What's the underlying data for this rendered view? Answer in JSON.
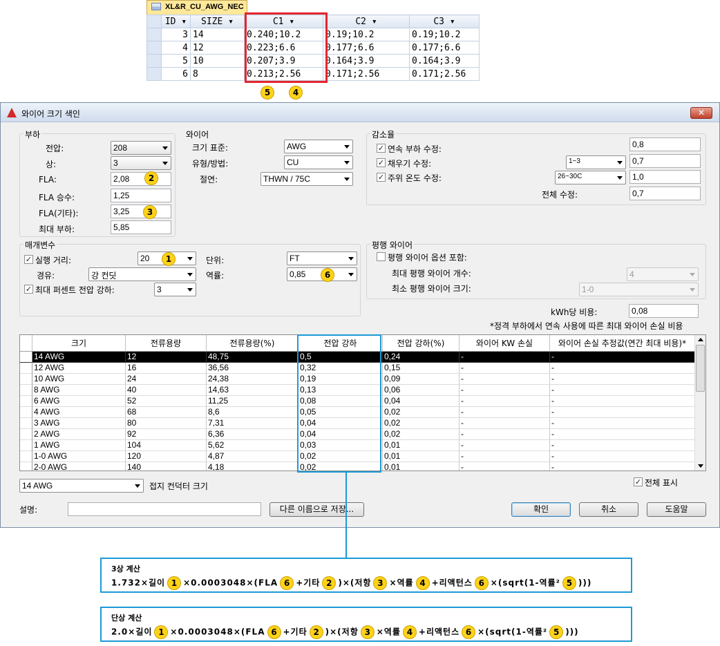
{
  "db": {
    "tab_title": "XL&R_CU_AWG_NEC",
    "headers": [
      "ID",
      "SIZE",
      "C1",
      "C2",
      "C3"
    ],
    "rows": [
      {
        "id": "3",
        "size": "14",
        "c1": "0.240;10.2",
        "c2": "0.19;10.2",
        "c3": "0.19;10.2"
      },
      {
        "id": "4",
        "size": "12",
        "c1": "0.223;6.6",
        "c2": "0.177;6.6",
        "c3": "0.177;6.6"
      },
      {
        "id": "5",
        "size": "10",
        "c1": "0.207;3.9",
        "c2": "0.164;3.9",
        "c3": "0.164;3.9"
      },
      {
        "id": "6",
        "size": "8",
        "c1": "0.213;2.56",
        "c2": "0.171;2.56",
        "c3": "0.171;2.56"
      }
    ]
  },
  "markers": {
    "m1": "1",
    "m2": "2",
    "m3": "3",
    "m4": "4",
    "m5": "5",
    "m6": "6"
  },
  "dialog": {
    "title": "와이어 크기 색인",
    "close": "✕",
    "load": {
      "legend": "부하",
      "voltage_label": "전압:",
      "voltage": "208",
      "phase_label": "상:",
      "phase": "3",
      "fla_label": "FLA:",
      "fla": "2,08",
      "fla_mult_label": "FLA 승수:",
      "fla_mult": "1,25",
      "fla_other_label": "FLA(기타):",
      "fla_other": "3,25",
      "max_load_label": "최대 부하:",
      "max_load": "5,85"
    },
    "wire": {
      "legend": "와이어",
      "size_std_label": "크기 표준:",
      "size_std": "AWG",
      "type_label": "유형/방법:",
      "type": "CU",
      "insulation_label": "절연:",
      "insulation": "THWN / 75C"
    },
    "derating": {
      "legend": "감소율",
      "continuous_label": "연속 부하 수정:",
      "continuous": "0,8",
      "fill_label": "채우기 수정:",
      "fill_combo": "1~3",
      "fill": "0,7",
      "temp_label": "주위 온도 수정:",
      "temp_combo": "26~30C",
      "temp": "1,0",
      "total_label": "전체 수정:",
      "total": "0,7"
    },
    "params": {
      "legend": "매개변수",
      "run_label": "실행 거리:",
      "run": "20",
      "unit_label": "단위:",
      "unit": "FT",
      "conduit_label": "경유:",
      "conduit": "강 컨딧",
      "pf_label": "역률:",
      "pf": "0,85",
      "max_drop_label": "최대 퍼센트 전압 강하:",
      "max_drop": "3"
    },
    "parallel": {
      "legend": "평행 와이어",
      "include_label": "평행 와이어 옵션 포함:",
      "max_count_label": "최대 평행 와이어 개수:",
      "max_count": "4",
      "min_size_label": "최소 평행 와이어 크기:",
      "min_size": "1-0"
    },
    "kwh_label": "kWh당 비용:",
    "kwh": "0,08",
    "note": "*정격 부하에서 연속 사용에 따른 최대 와이어 손실 비용",
    "grid": {
      "headers": [
        "크기",
        "전류용량",
        "전류용량(%)",
        "전압 강하",
        "전압 강하(%)",
        "와이어 KW 손실",
        "와이어 손실 추정값(연간 최대 비용)*"
      ],
      "rows": [
        [
          "14 AWG",
          "12",
          "48,75",
          "0,5",
          "0,24",
          "-",
          "-"
        ],
        [
          "12 AWG",
          "16",
          "36,56",
          "0,32",
          "0,15",
          "-",
          "-"
        ],
        [
          "10 AWG",
          "24",
          "24,38",
          "0,19",
          "0,09",
          "-",
          "-"
        ],
        [
          "8 AWG",
          "40",
          "14,63",
          "0,13",
          "0,06",
          "-",
          "-"
        ],
        [
          "6 AWG",
          "52",
          "11,25",
          "0,08",
          "0,04",
          "-",
          "-"
        ],
        [
          "4 AWG",
          "68",
          "8,6",
          "0,05",
          "0,02",
          "-",
          "-"
        ],
        [
          "3 AWG",
          "80",
          "7,31",
          "0,04",
          "0,02",
          "-",
          "-"
        ],
        [
          "2 AWG",
          "92",
          "6,36",
          "0,04",
          "0,02",
          "-",
          "-"
        ],
        [
          "1 AWG",
          "104",
          "5,62",
          "0,03",
          "0,01",
          "-",
          "-"
        ],
        [
          "1-0 AWG",
          "120",
          "4,87",
          "0,02",
          "0,01",
          "-",
          "-"
        ],
        [
          "2-0 AWG",
          "140",
          "4,18",
          "0,02",
          "0,01",
          "-",
          "-"
        ]
      ]
    },
    "ground_combo": "14 AWG",
    "ground_label": "접지 컨덕터 크기",
    "show_all_label": "전체 표시",
    "desc_label": "설명:",
    "desc_value": "",
    "save_as": "다른 이름으로 저장...",
    "ok": "확인",
    "cancel": "취소",
    "help": "도움말"
  },
  "formulas": {
    "three_phase": {
      "title": "3상 계산",
      "p1": "1.732×길이",
      "p2": "×0.0003048×(FLA",
      "p3": "+기타",
      "p4": ")×(저항",
      "p5": "×역률",
      "p6": "+리액턴스",
      "p7": "×(sqrt(1-역률²",
      "p8": ")))"
    },
    "single_phase": {
      "title": "단상 계산",
      "p1": "2.0×길이",
      "p2": "×0.0003048×(FLA",
      "p3": "+기타",
      "p4": ")×(저항",
      "p5": "×역률",
      "p6": "+리액턴스",
      "p7": "×(sqrt(1-역률²",
      "p8": ")))"
    }
  },
  "colors": {
    "red_highlight": "#e4262e",
    "blue_highlight": "#1c9ad6",
    "marker": "#ffd21a"
  }
}
